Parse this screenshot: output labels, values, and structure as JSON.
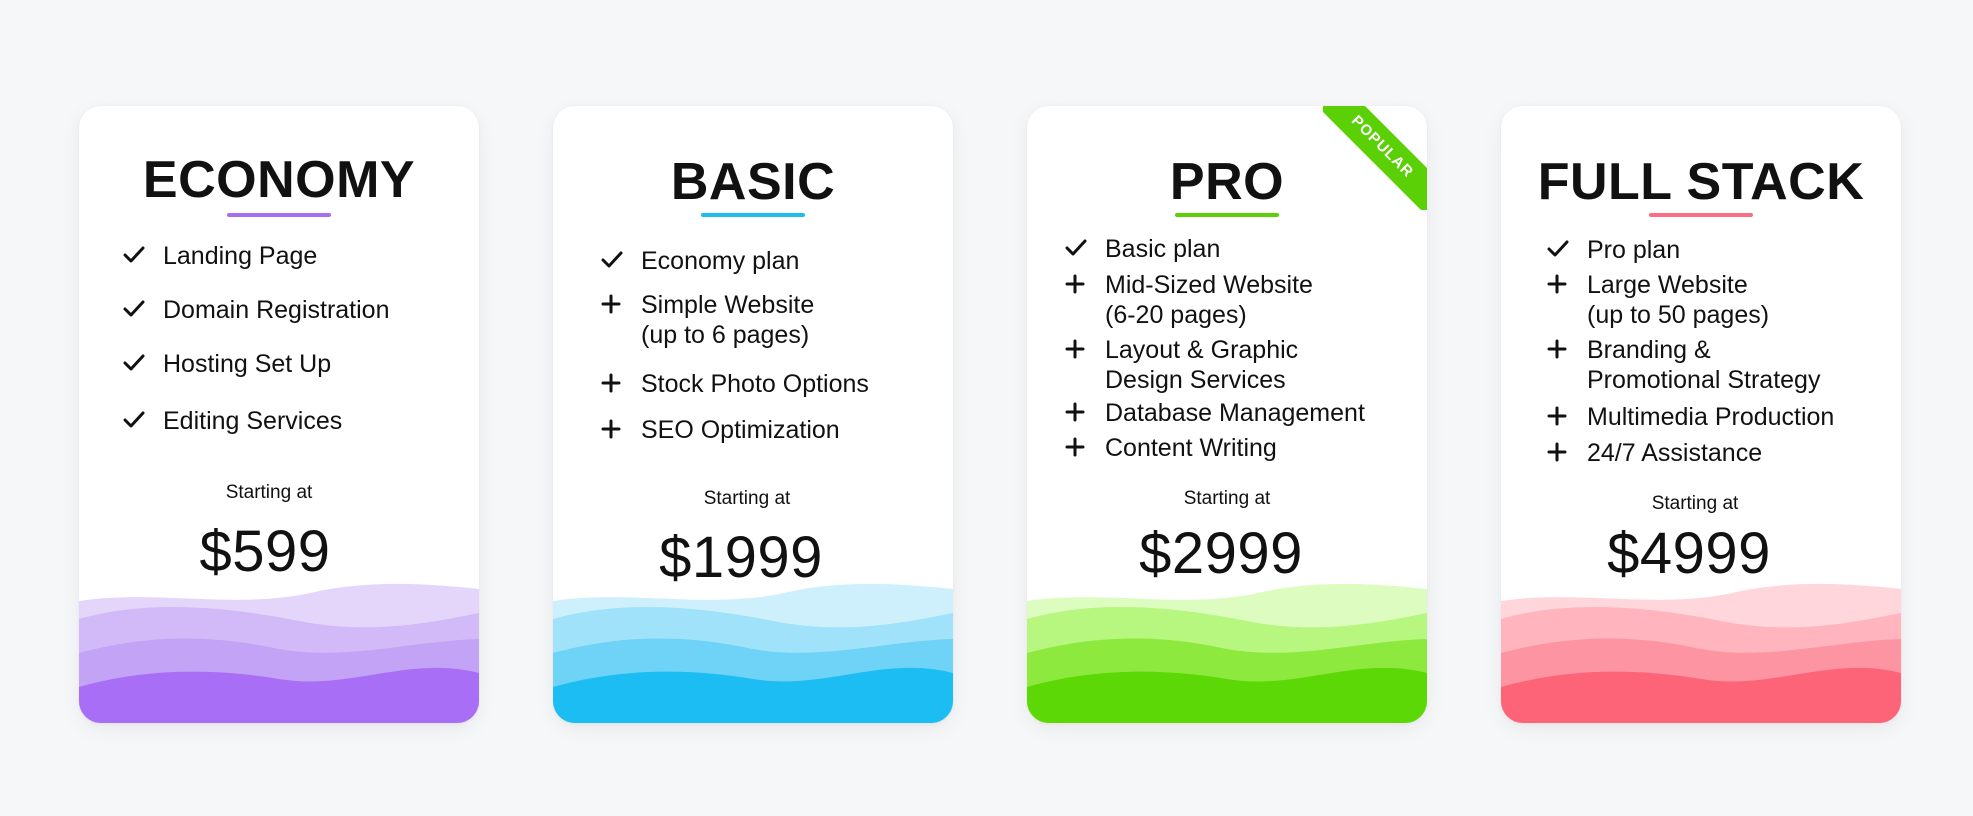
{
  "plans": [
    {
      "id": "economy",
      "title": "ECONOMY",
      "accent": "#a56ef3",
      "wave_colors": [
        "#e4d5fb",
        "#d2b9f8",
        "#c3a3f6",
        "#a86ef5"
      ],
      "features": [
        {
          "icon": "check-icon",
          "text": "Landing Page"
        },
        {
          "icon": "check-icon",
          "text": "Domain Registration"
        },
        {
          "icon": "check-icon",
          "text": "Hosting Set Up"
        },
        {
          "icon": "check-icon",
          "text": "Editing Services"
        }
      ],
      "starting_label": "Starting at",
      "price": "$599"
    },
    {
      "id": "basic",
      "title": "BASIC",
      "accent": "#1cbdf3",
      "wave_colors": [
        "#cdf0fc",
        "#9fe2fa",
        "#6fd2f7",
        "#1cbdf3"
      ],
      "features": [
        {
          "icon": "check-icon",
          "text": "Economy plan"
        },
        {
          "icon": "plus-icon",
          "text": "Simple Website\n(up to 6 pages)"
        },
        {
          "icon": "plus-icon",
          "text": "Stock Photo Options"
        },
        {
          "icon": "plus-icon",
          "text": "SEO Optimization"
        }
      ],
      "starting_label": "Starting at",
      "price": "$1999"
    },
    {
      "id": "pro",
      "title": "PRO",
      "accent": "#5cd007",
      "badge": "POPULAR",
      "wave_colors": [
        "#dcfdbf",
        "#b7f77f",
        "#8ee93f",
        "#5cd807"
      ],
      "features": [
        {
          "icon": "check-icon",
          "text": "Basic plan"
        },
        {
          "icon": "plus-icon",
          "text": "Mid-Sized Website\n(6-20 pages)"
        },
        {
          "icon": "plus-icon",
          "text": "Layout & Graphic\nDesign Services"
        },
        {
          "icon": "plus-icon",
          "text": "Database Management"
        },
        {
          "icon": "plus-icon",
          "text": "Content Writing"
        }
      ],
      "starting_label": "Starting at",
      "price": "$2999"
    },
    {
      "id": "full-stack",
      "title": "FULL STACK",
      "accent": "#fb6d80",
      "wave_colors": [
        "#ffd6dc",
        "#ffb4be",
        "#fd94a2",
        "#fe6478"
      ],
      "features": [
        {
          "icon": "check-icon",
          "text": "Pro plan"
        },
        {
          "icon": "plus-icon",
          "text": "Large Website\n(up to 50 pages)"
        },
        {
          "icon": "plus-icon",
          "text": "Branding &\nPromotional Strategy"
        },
        {
          "icon": "plus-icon",
          "text": "Multimedia Production"
        },
        {
          "icon": "plus-icon",
          "text": "24/7 Assistance"
        }
      ],
      "starting_label": "Starting at",
      "price": "$4999"
    }
  ]
}
